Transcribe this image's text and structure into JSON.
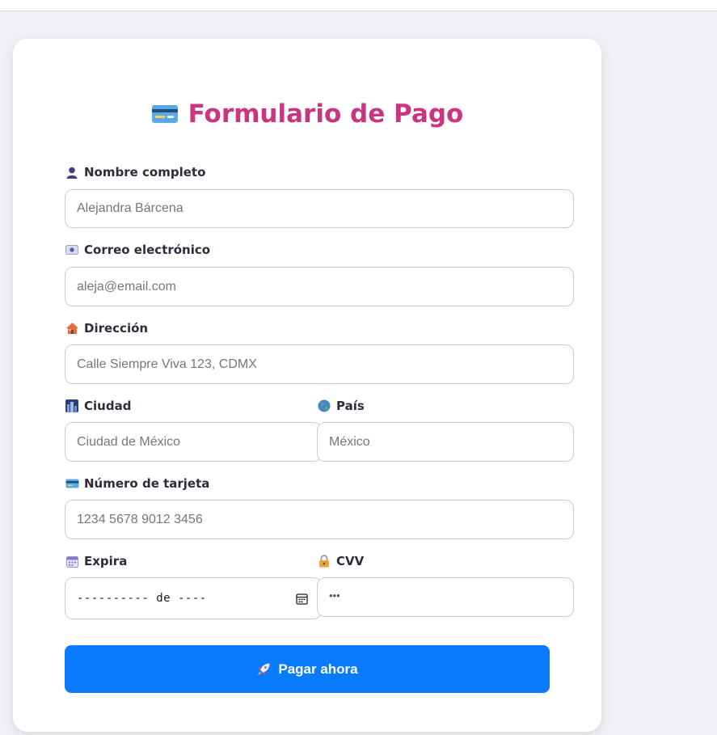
{
  "form": {
    "title": "Formulario de Pago",
    "title_icon": "credit-card-icon",
    "fields": {
      "name": {
        "label": "Nombre completo",
        "icon": "person-icon",
        "placeholder": "Alejandra Bárcena"
      },
      "email": {
        "label": "Correo electrónico",
        "icon": "email-icon",
        "placeholder": "aleja@email.com"
      },
      "address": {
        "label": "Dirección",
        "icon": "house-icon",
        "placeholder": "Calle Siempre Viva 123, CDMX"
      },
      "city": {
        "label": "Ciudad",
        "icon": "cityscape-icon",
        "placeholder": "Ciudad de México"
      },
      "country": {
        "label": "País",
        "icon": "globe-icon",
        "placeholder": "México"
      },
      "card_number": {
        "label": "Número de tarjeta",
        "icon": "credit-card-icon",
        "placeholder": "1234 5678 9012 3456"
      },
      "expiry": {
        "label": "Expira",
        "icon": "calendar-icon",
        "value": "---------- de ----"
      },
      "cvv": {
        "label": "CVV",
        "icon": "lock-icon",
        "placeholder": "•••"
      }
    },
    "submit": {
      "label": "Pagar ahora",
      "icon": "rocket-icon"
    }
  },
  "colors": {
    "title": "#c9357e",
    "button": "#0a7bff",
    "page_background": "#f0f1f6"
  }
}
